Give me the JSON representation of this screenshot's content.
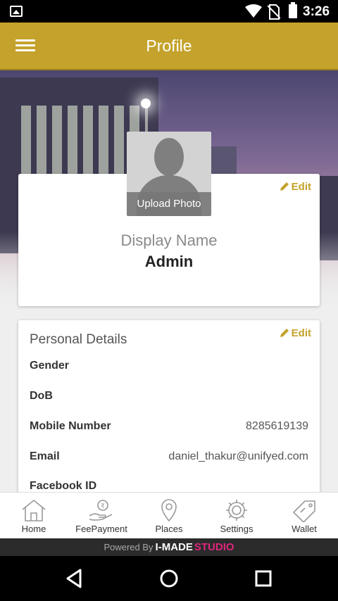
{
  "status_bar": {
    "time": "3:26"
  },
  "app_bar": {
    "title": "Profile"
  },
  "profile": {
    "upload_photo_label": "Upload Photo",
    "edit_label": "Edit",
    "display_name_label": "Display Name",
    "display_name_value": "Admin"
  },
  "personal_details": {
    "title": "Personal Details",
    "edit_label": "Edit",
    "rows": [
      {
        "label": "Gender",
        "value": ""
      },
      {
        "label": "DoB",
        "value": ""
      },
      {
        "label": "Mobile Number",
        "value": "8285619139"
      },
      {
        "label": "Email",
        "value": "daniel_thakur@unifyed.com"
      },
      {
        "label": "Facebook ID",
        "value": ""
      }
    ]
  },
  "bottom_nav": {
    "items": [
      {
        "label": "Home",
        "icon": "home-icon"
      },
      {
        "label": "FeePayment",
        "icon": "fee-payment-icon"
      },
      {
        "label": "Places",
        "icon": "places-icon"
      },
      {
        "label": "Settings",
        "icon": "gear-icon"
      },
      {
        "label": "Wallet",
        "icon": "wallet-icon"
      }
    ]
  },
  "powered_by": {
    "text": "Powered By",
    "brand": "I-MADE",
    "brand_suffix": "STUDIO"
  },
  "colors": {
    "accent": "#c4a22c",
    "powered_by_studio": "#e0257d"
  }
}
